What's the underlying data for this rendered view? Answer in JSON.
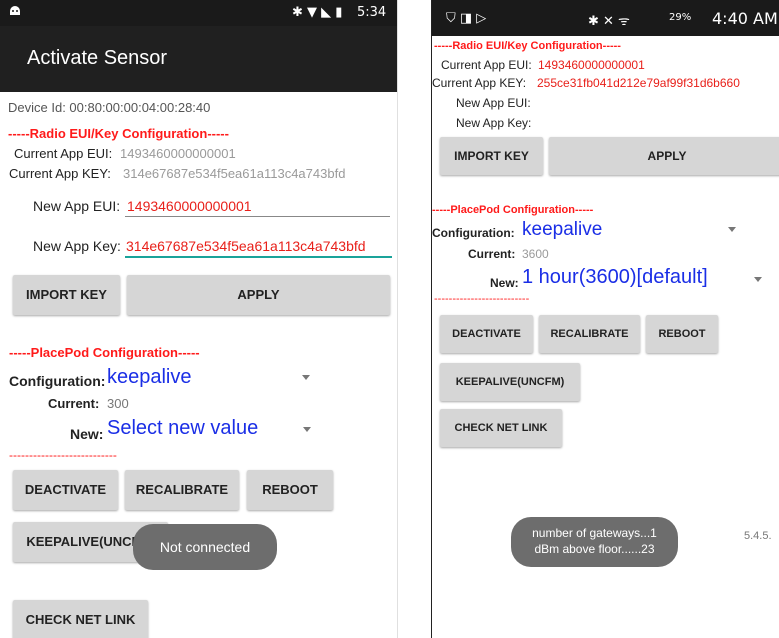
{
  "left": {
    "status": {
      "time": "5:34",
      "icons": "✱ ▼ ◣ ▮"
    },
    "title": "Activate Sensor",
    "device_id": "Device Id: 00:80:00:00:04:00:28:40",
    "radio_header": "-----Radio EUI/Key Configuration-----",
    "current_eui_label": "Current App EUI:",
    "current_eui_value": "1493460000000001",
    "current_key_label": "Current App KEY:",
    "current_key_value": "314e67687e534f5ea61a113c4a743bfd",
    "new_eui_label": "New App EUI:",
    "new_eui_value": "1493460000000001",
    "new_key_label": "New App Key:",
    "new_key_value": "314e67687e534f5ea61a113c4a743bfd",
    "import_label": "IMPORT KEY",
    "apply_label": "APPLY",
    "placepod_header": "-----PlacePod Configuration-----",
    "config_label": "Configuration:",
    "config_value": "keepalive",
    "current_label": "Current:",
    "current_value": "300",
    "new_label": "New:",
    "new_value": "Select new value",
    "divider": "---------------------------",
    "deactivate": "DEACTIVATE",
    "recalibrate": "RECALIBRATE",
    "reboot": "REBOOT",
    "keepalive": "KEEPALIVE(UNCFM)",
    "netlink": "CHECK NET LINK",
    "toast": "Not connected"
  },
  "right": {
    "status": {
      "time": "4:40 AM",
      "battery": "29%",
      "icons": "✱ ✕ ᯤ"
    },
    "radio_header": "-----Radio EUI/Key Configuration-----",
    "current_eui_label": "Current App EUI:",
    "current_eui_value": "1493460000000001",
    "current_key_label": "Current App KEY:",
    "current_key_value": "255ce31fb041d212e79af99f31d6b660",
    "new_eui_label": "New App EUI:",
    "new_key_label": "New App Key:",
    "import_label": "IMPORT KEY",
    "apply_label": "APPLY",
    "placepod_header": "-----PlacePod Configuration-----",
    "config_label": "Configuration:",
    "config_value": "keepalive",
    "current_label": "Current:",
    "current_value": "3600",
    "new_label": "New:",
    "new_value": "1 hour(3600)[default]",
    "divider": "--------------------------",
    "deactivate": "DEACTIVATE",
    "recalibrate": "RECALIBRATE",
    "reboot": "REBOOT",
    "keepalive": "KEEPALIVE(UNCFM)",
    "netlink": "CHECK NET LINK",
    "toast_line1": "number of gateways...1",
    "toast_line2": "dBm above floor......23",
    "version": "5.4.5."
  }
}
